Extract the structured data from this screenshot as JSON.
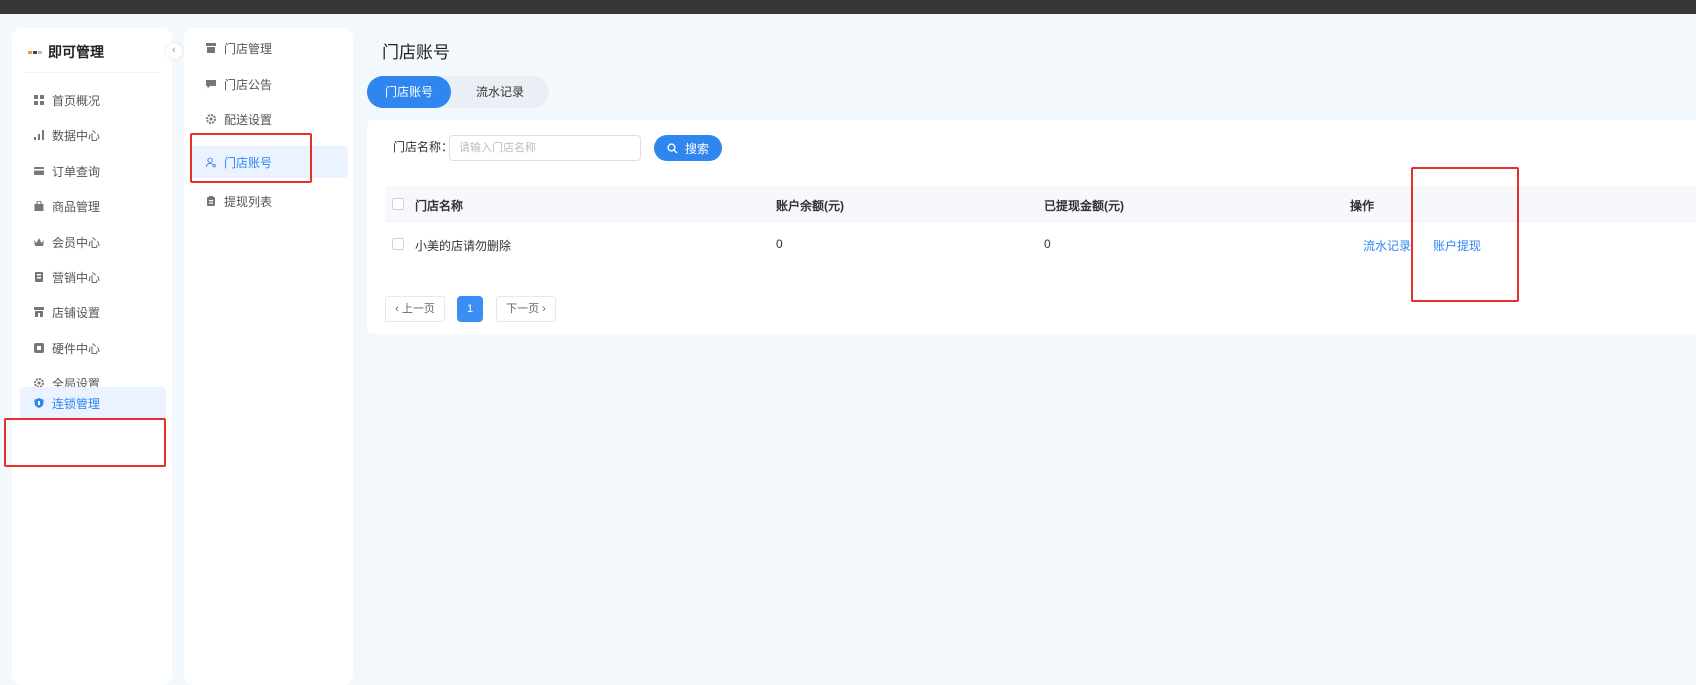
{
  "brand": {
    "name": "即可管理"
  },
  "sidebar": {
    "collapse_glyph": "‹",
    "items": [
      {
        "label": "首页概况",
        "icon": "grid-icon"
      },
      {
        "label": "数据中心",
        "icon": "bar-chart-icon"
      },
      {
        "label": "订单查询",
        "icon": "wallet-icon"
      },
      {
        "label": "商品管理",
        "icon": "bag-icon"
      },
      {
        "label": "会员中心",
        "icon": "crown-icon"
      },
      {
        "label": "营销中心",
        "icon": "gift-icon"
      },
      {
        "label": "店铺设置",
        "icon": "store-icon"
      },
      {
        "label": "硬件中心",
        "icon": "chip-icon"
      },
      {
        "label": "全局设置",
        "icon": "gear-icon"
      },
      {
        "label": "连锁管理",
        "icon": "shield-icon",
        "active": true
      }
    ]
  },
  "subnav": {
    "items": [
      {
        "label": "门店管理",
        "icon": "store-icon"
      },
      {
        "label": "门店公告",
        "icon": "message-icon"
      },
      {
        "label": "配送设置",
        "icon": "gear-icon"
      },
      {
        "label": "门店账号",
        "icon": "user-icon",
        "active": true
      },
      {
        "label": "提现列表",
        "icon": "clipboard-icon"
      }
    ]
  },
  "page": {
    "title": "门店账号"
  },
  "tabs": [
    {
      "label": "门店账号",
      "active": true
    },
    {
      "label": "流水记录",
      "active": false
    }
  ],
  "search": {
    "label": "门店名称：",
    "placeholder": "请输入门店名称",
    "button_label": "搜索"
  },
  "table": {
    "columns": [
      "门店名称",
      "账户余额(元)",
      "已提现金额(元)",
      "操作"
    ],
    "rows": [
      {
        "name": "小美的店请勿删除",
        "balance": "0",
        "withdrawn": "0",
        "actions": [
          "流水记录",
          "账户提现"
        ]
      }
    ]
  },
  "pagination": {
    "prev_label": "‹ 上一页",
    "current": "1",
    "next_label": "下一页 ›"
  },
  "colors": {
    "accent": "#2f86ef",
    "highlight": "#e8302a",
    "topbar": "#373737",
    "background": "#f3f8fc"
  }
}
